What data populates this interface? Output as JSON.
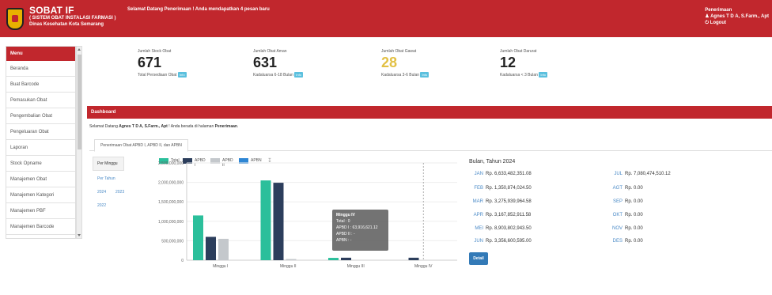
{
  "header": {
    "app_title": "SOBAT IF",
    "app_subtitle": "( SISTEM OBAT INSTALASI FARMASI )",
    "org": "Dinas Kesehatan Kota Semarang",
    "welcome": "Selamat Datang Penerimaan ! Anda mendapatkan 4 pesan baru",
    "role": "Penerimaan",
    "user_name": "Agnes T D A, S.Farm., Apt",
    "logout": "Logout"
  },
  "sidebar": {
    "title": "Menu",
    "items": [
      "Beranda",
      "Buat Barcode",
      "Pemasukan Obat",
      "Pengembalian Obat",
      "Pengeluaran Obat",
      "Laporan",
      "Stock Opname",
      "Manajemen Obat",
      "Manajemen Kategori",
      "Manajemen PBF",
      "Manajemen Barcode"
    ]
  },
  "stats": [
    {
      "label": "Jumlah Stock Obat",
      "value": "671",
      "sub": "Total Persediaan Obat",
      "color": "#222"
    },
    {
      "label": "Jumlah Obat Aman",
      "value": "631",
      "sub": "Kadaluarsa 6-18 Bulan",
      "color": "#222"
    },
    {
      "label": "Jumlah Obat Gawat",
      "value": "28",
      "sub": "Kadaluarsa 3-6 Bulan",
      "color": "#e2c044"
    },
    {
      "label": "Jumlah Obat Darurat",
      "value": "12",
      "sub": "Kadaluarsa < 3 Bulan",
      "color": "#222"
    }
  ],
  "info_label": "Info",
  "dashboard": {
    "title": "Dashboard",
    "greet_pre": "Selamat Datang ",
    "greet_name": "Agnes T D A, S.Farm., Apt",
    "greet_mid": " ! Anda berada di halaman ",
    "greet_page": "Penerimaan",
    "greet_end": ".",
    "tab": "Penerimaan Obat APBD I, APBD II, dan APBN"
  },
  "pills": {
    "per_minggu": "Per Minggu",
    "per_tahun": "Per Tahun",
    "y2024": "2024",
    "y2023": "2023",
    "y2022": "2022"
  },
  "chart_data": {
    "type": "bar",
    "categories": [
      "Minggu I",
      "Minggu II",
      "Minggu III",
      "Minggu IV"
    ],
    "series": [
      {
        "name": "Total",
        "color": "#2bbf9b",
        "values": [
          1150000000,
          2050000000,
          60000000,
          0
        ]
      },
      {
        "name": "APBD I",
        "color": "#2c3e5c",
        "values": [
          600000000,
          1990000000,
          63916621.12,
          63916621.12
        ]
      },
      {
        "name": "APBD II",
        "color": "#c4c8cc",
        "values": [
          550000000,
          30000000,
          0,
          0
        ]
      },
      {
        "name": "APBN",
        "color": "#2e86d4",
        "values": [
          0,
          0,
          0,
          0
        ]
      }
    ],
    "yticks": [
      "0",
      "500,000,000",
      "1,000,000,000",
      "1,500,000,000",
      "2,000,000,000",
      "2,500,000,000"
    ],
    "ylim": [
      0,
      2500000000
    ]
  },
  "tooltip": {
    "title": "Minggu IV",
    "l1": "Total : 0",
    "l2": "APBD I : 63,916,621.12",
    "l3": "APBD II : -",
    "l4": "APBN : -"
  },
  "summary": {
    "title": "Bulan, Tahun 2024",
    "left": [
      {
        "m": "JAN",
        "v": "Rp. 6,633,482,351.08"
      },
      {
        "m": "FEB",
        "v": "Rp. 1,350,874,024.50"
      },
      {
        "m": "MAR",
        "v": "Rp. 3,275,939,964.58"
      },
      {
        "m": "APR",
        "v": "Rp. 3,167,852,911.58"
      },
      {
        "m": "MEI",
        "v": "Rp. 8,903,802,943.50"
      },
      {
        "m": "JUN",
        "v": "Rp. 3,356,600,595.00"
      }
    ],
    "right": [
      {
        "m": "JUL",
        "v": "Rp. 7,080,474,510.12"
      },
      {
        "m": "AGT",
        "v": "Rp. 0.00"
      },
      {
        "m": "SEP",
        "v": "Rp. 0.00"
      },
      {
        "m": "OKT",
        "v": "Rp. 0.00"
      },
      {
        "m": "NOV",
        "v": "Rp. 0.00"
      },
      {
        "m": "DES",
        "v": "Rp. 0.00"
      }
    ],
    "detail": "Detail"
  }
}
